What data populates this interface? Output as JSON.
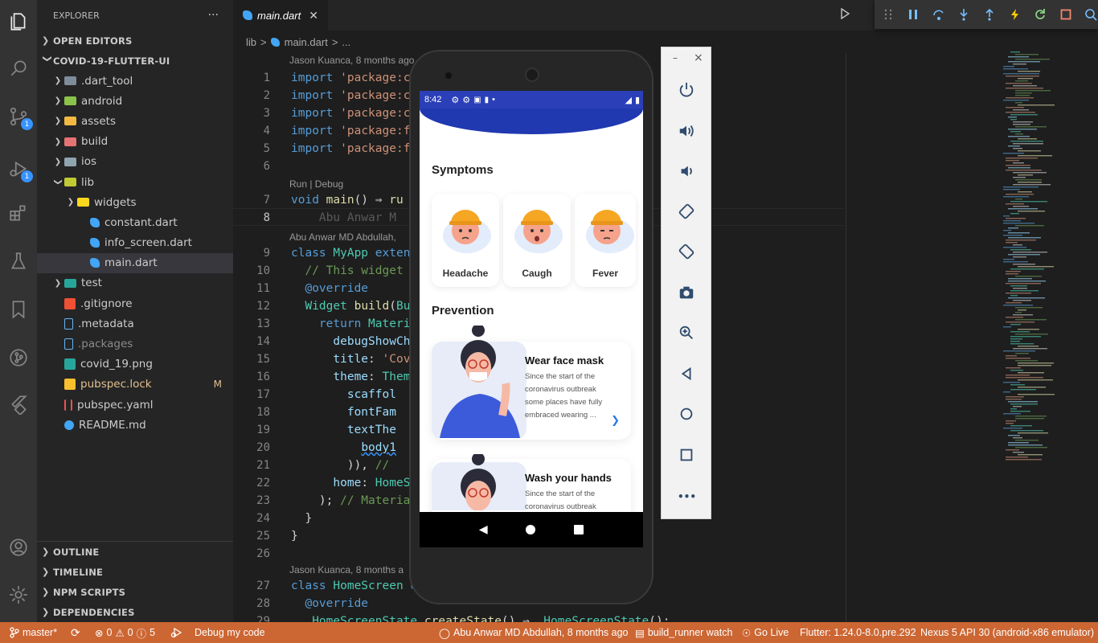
{
  "explorer": {
    "title": "EXPLORER",
    "more": "···",
    "open_editors": "OPEN EDITORS",
    "project": "COVID-19-FLUTTER-UI",
    "tree": [
      {
        "label": ".dart_tool",
        "type": "folder",
        "color": "#7f8c9a"
      },
      {
        "label": "android",
        "type": "folder",
        "color": "#8bc34a"
      },
      {
        "label": "assets",
        "type": "folder",
        "color": "#f4b942"
      },
      {
        "label": "build",
        "type": "folder",
        "color": "#e57373"
      },
      {
        "label": "ios",
        "type": "folder",
        "color": "#90a4ae"
      },
      {
        "label": "lib",
        "type": "folder-open",
        "color": "#c0ca33"
      },
      {
        "label": "widgets",
        "type": "folder",
        "color": "#f9d71c"
      },
      {
        "label": "constant.dart",
        "type": "dart",
        "color": "#42a5f5"
      },
      {
        "label": "info_screen.dart",
        "type": "dart",
        "color": "#42a5f5"
      },
      {
        "label": "main.dart",
        "type": "dart",
        "color": "#42a5f5"
      },
      {
        "label": "test",
        "type": "folder",
        "color": "#26a69a"
      },
      {
        "label": ".gitignore",
        "type": "git",
        "color": "#f05033"
      },
      {
        "label": ".metadata",
        "type": "file",
        "color": "#64b5f6"
      },
      {
        "label": ".packages",
        "type": "file",
        "color": "#64b5f6"
      },
      {
        "label": "covid_19.png",
        "type": "image",
        "color": "#26a69a"
      },
      {
        "label": "pubspec.lock",
        "type": "lock",
        "color": "#fbc02d",
        "badge": "M"
      },
      {
        "label": "pubspec.yaml",
        "type": "yaml",
        "color": "#ef5350"
      },
      {
        "label": "README.md",
        "type": "info",
        "color": "#42a5f5"
      }
    ],
    "bottom_sections": [
      "OUTLINE",
      "TIMELINE",
      "NPM SCRIPTS",
      "DEPENDENCIES"
    ]
  },
  "editor": {
    "tab_label": "main.dart",
    "tab_close": "✕",
    "breadcrumb": [
      "lib",
      ">",
      "main.dart",
      ">",
      "..."
    ],
    "blame_1": "Jason Kuanca, 8 months ago",
    "blame_2": "Abu Anwar MD Abdullah,",
    "blame_3": "Jason Kuanca, 8 months a",
    "codelens": "Run | Debug",
    "ghost": "Abu Anwar M",
    "line_numbers": [
      "1",
      "2",
      "3",
      "4",
      "5",
      "6",
      "7",
      "8",
      "9",
      "10",
      "11",
      "12",
      "13",
      "14",
      "15",
      "16",
      "17",
      "18",
      "19",
      "20",
      "21",
      "22",
      "23",
      "24",
      "25",
      "26",
      "27",
      "28",
      "29"
    ],
    "current_line": "8"
  },
  "phone": {
    "time": "8:42",
    "symptoms_title": "Symptoms",
    "symptoms": [
      "Headache",
      "Caugh",
      "Fever"
    ],
    "prevention_title": "Prevention",
    "cards": [
      {
        "title": "Wear face mask",
        "desc": "Since the start of the coronavirus outbreak some places have fully embraced wearing ..."
      },
      {
        "title": "Wash your hands",
        "desc": "Since the start of the coronavirus outbreak"
      }
    ]
  },
  "emulator": {
    "minimize": "–",
    "close": "×",
    "more": "•••"
  },
  "statusbar": {
    "branch": "master*",
    "errors": "0",
    "warnings": "0",
    "infos": "5",
    "debug": "Debug my code",
    "blame": "Abu Anwar MD Abdullah, 8 months ago",
    "task": "build_runner watch",
    "golive": "Go Live",
    "flutter": "Flutter: 1.24.0-8.0.pre.292",
    "device": "Nexus 5 API 30 (android-x86 emulator)"
  }
}
